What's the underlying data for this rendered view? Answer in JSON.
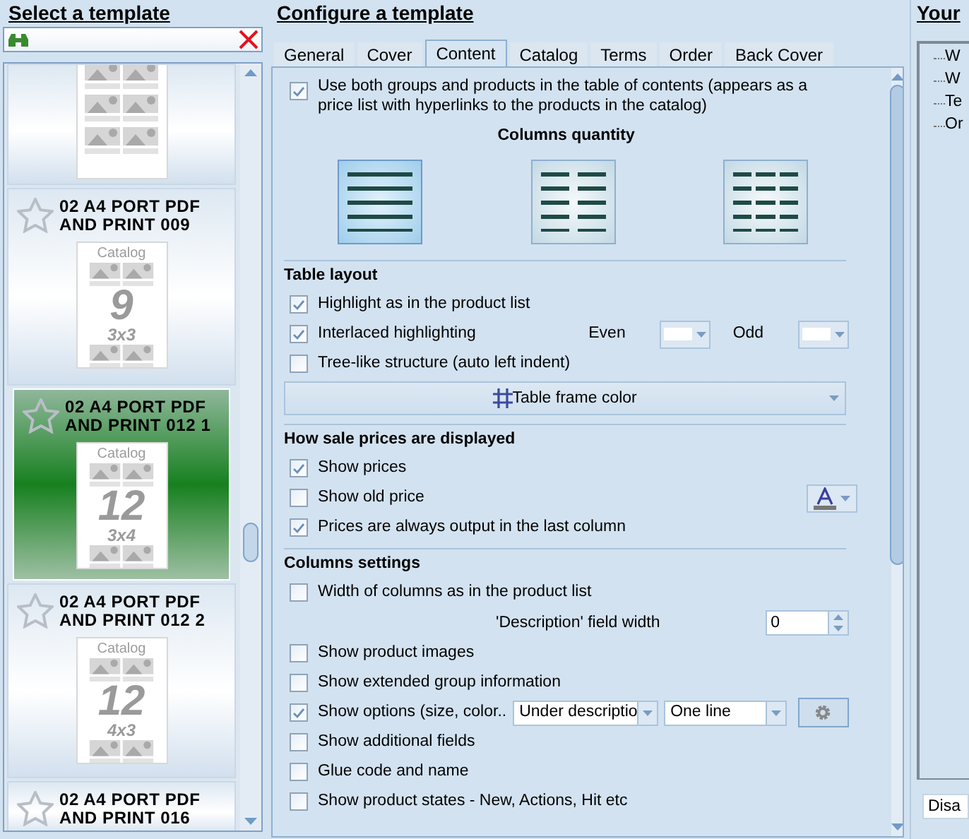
{
  "left_panel": {
    "title": "Select a template",
    "templates": [
      {
        "selected": false,
        "thumbnail": {
          "kind": "photos"
        }
      },
      {
        "name": "02 A4 PORT PDF\nAND PRINT 009",
        "selected": false,
        "favorite": false,
        "thumbnail": {
          "kind": "numbered",
          "label": "Catalog",
          "number": "9",
          "grid": "3x3"
        }
      },
      {
        "name": "02 A4 PORT PDF\nAND PRINT 012 1",
        "selected": true,
        "favorite": false,
        "thumbnail": {
          "kind": "numbered",
          "label": "Catalog",
          "number": "12",
          "grid": "3x4"
        }
      },
      {
        "name": "02 A4 PORT PDF\nAND PRINT 012 2",
        "selected": false,
        "favorite": false,
        "thumbnail": {
          "kind": "numbered",
          "label": "Catalog",
          "number": "12",
          "grid": "4x3"
        }
      },
      {
        "name": "02 A4 PORT PDF\nAND PRINT 016",
        "selected": false,
        "favorite": false
      }
    ]
  },
  "config": {
    "title": "Configure a template",
    "tabs": [
      {
        "label": "General",
        "selected": false
      },
      {
        "label": "Cover",
        "selected": false
      },
      {
        "label": "Content",
        "selected": true
      },
      {
        "label": "Catalog",
        "selected": false
      },
      {
        "label": "Terms",
        "selected": false
      },
      {
        "label": "Order",
        "selected": false
      },
      {
        "label": "Back Cover",
        "selected": false
      }
    ],
    "toc_option": {
      "label": "Use both groups and products in the table of contents (appears as a price list with hyperlinks to the products in the catalog)",
      "checked": true
    },
    "columns_quantity": {
      "title": "Columns quantity",
      "options": [
        {
          "kind": "one",
          "selected": true
        },
        {
          "kind": "two",
          "selected": false
        },
        {
          "kind": "three",
          "selected": false
        }
      ]
    },
    "sections": [
      {
        "title": "Table layout",
        "rows": [
          {
            "kind": "check",
            "label": "Highlight as in the product list",
            "checked": true
          },
          {
            "kind": "check",
            "label": "Interlaced highlighting",
            "checked": true,
            "color_pickers": [
              {
                "label": "Even",
                "color": "#ffffff"
              },
              {
                "label": "Odd",
                "color": "#ffffff"
              }
            ]
          },
          {
            "kind": "check",
            "label": "Tree-like structure (auto left indent)",
            "checked": false
          },
          {
            "kind": "button",
            "label": "Table frame color"
          }
        ]
      },
      {
        "title": "How sale prices are displayed",
        "rows": [
          {
            "kind": "check",
            "label": "Show prices",
            "checked": true
          },
          {
            "kind": "check",
            "label": "Show old price",
            "checked": false,
            "font_color": true
          },
          {
            "kind": "check",
            "label": "Prices are always output in the last column",
            "checked": true
          }
        ]
      },
      {
        "title": "Columns settings",
        "rows": [
          {
            "kind": "check",
            "label": "Width of columns as in the product list",
            "checked": false
          },
          {
            "kind": "spin",
            "label": "'Description' field width",
            "value": "0"
          },
          {
            "kind": "check",
            "label": "Show product images",
            "checked": false
          },
          {
            "kind": "check",
            "label": "Show extended group information",
            "checked": false
          },
          {
            "kind": "check",
            "label": "Show options (size, color..",
            "checked": true,
            "selects": [
              "Under descriptio",
              "One line"
            ],
            "settings": true
          },
          {
            "kind": "check",
            "label": "Show additional fields",
            "checked": false
          },
          {
            "kind": "check",
            "label": "Glue code and name",
            "checked": false
          },
          {
            "kind": "check",
            "label": "Show product states - New, Actions, Hit etc",
            "checked": false
          }
        ]
      }
    ]
  },
  "right_panel": {
    "title": "Your",
    "tree": [
      {
        "label": "W"
      },
      {
        "label": "W"
      },
      {
        "label": "Te"
      },
      {
        "label": "Or"
      }
    ],
    "button": "Disa"
  }
}
